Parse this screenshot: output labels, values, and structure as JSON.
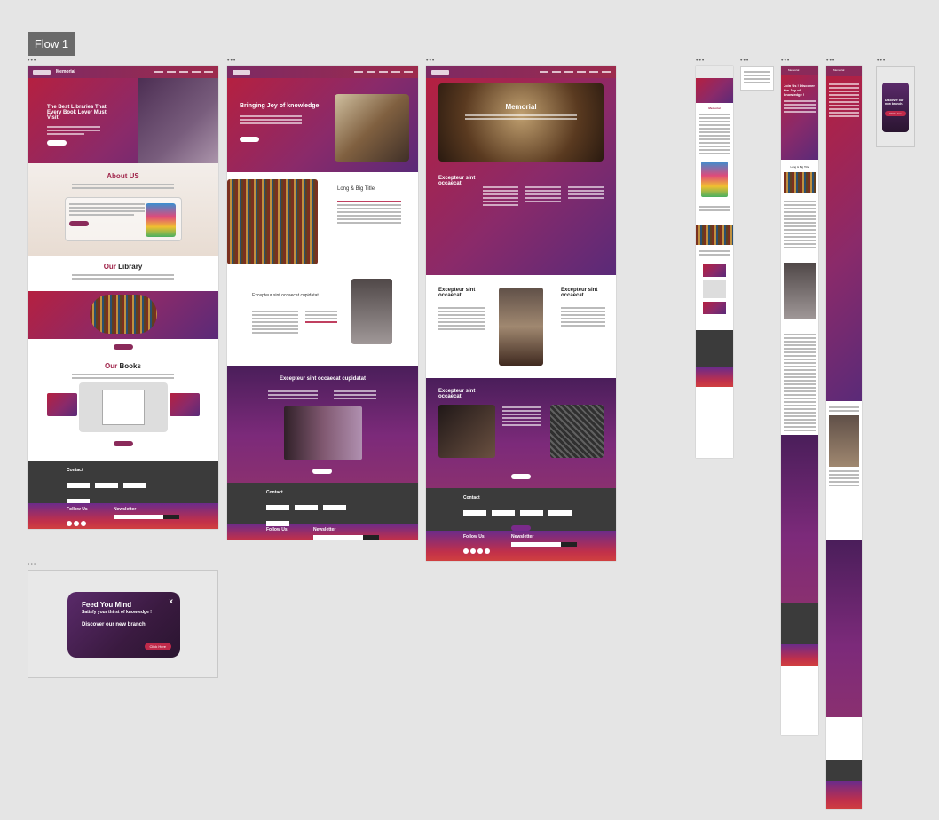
{
  "canvas": {
    "flow_label": "Flow 1"
  },
  "frame1": {
    "brand": "Memorial",
    "hero_title": "The Best Libraries That Every Book Lover Must Visit!",
    "about_heading_a": "About",
    "about_heading_b": "US",
    "library_heading_a": "Our",
    "library_heading_b": "Library",
    "books_heading_a": "Our",
    "books_heading_b": "Books",
    "contact_label": "Contact",
    "follow_label": "Follow Us",
    "newsletter_label": "Newsletter"
  },
  "frame2": {
    "hero_title": "Bringing Joy of knowledge",
    "section_title": "Long & Big Title",
    "sub_title": "Excepteur sint occaecat cupidatat.",
    "band_title": "Excepteur sint occaecat cupidatat",
    "contact_label": "Contact",
    "follow_label": "Follow Us",
    "newsletter_label": "Newsletter"
  },
  "frame3": {
    "hero_title": "Memorial",
    "section_title": "Excepteur sint occaecat",
    "col_a_title": "Excepteur sint occaecat",
    "col_b_title": "Excepteur sint occaecat",
    "band_title": "Excepteur sint occaecat",
    "contact_label": "Contact",
    "follow_label": "Follow Us",
    "newsletter_label": "Newsletter"
  },
  "popup": {
    "title": "Feed You Mind",
    "subtitle": "Satisfy your thirst of knowledge !",
    "body": "Discover our new branch.",
    "cta": "Click Here",
    "close": "x"
  },
  "mobile": {
    "m1_title": "Memorial",
    "m2_title": "Memorial",
    "m2_hero": "Join Us ! Discover the Joy of knowledge !",
    "m2_section": "Long & Big Title",
    "m3_title": "Memorial",
    "m4_text": "Discover our new branch.",
    "m4_cta": "Click Here"
  }
}
